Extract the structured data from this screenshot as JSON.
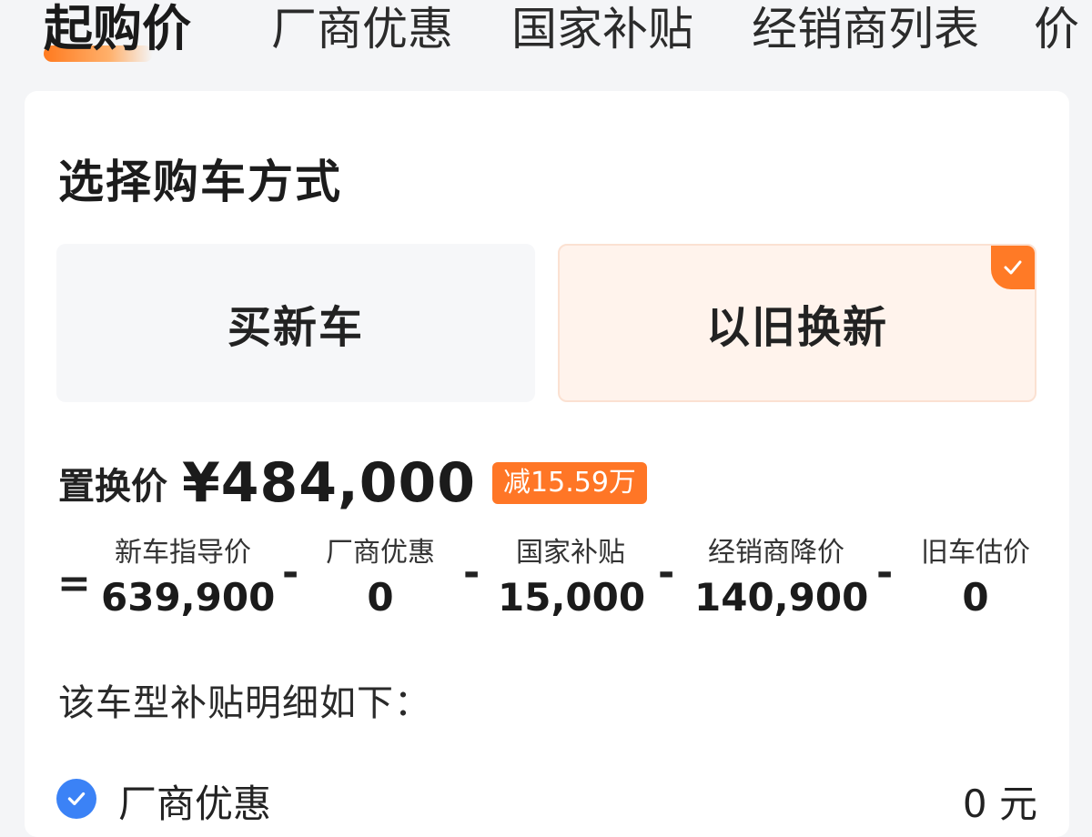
{
  "tabs": [
    {
      "label": "起购价",
      "active": true
    },
    {
      "label": "厂商优惠",
      "active": false
    },
    {
      "label": "国家补贴",
      "active": false
    },
    {
      "label": "经销商列表",
      "active": false
    },
    {
      "label": "价",
      "active": false
    }
  ],
  "purchase_method": {
    "title": "选择购车方式",
    "options": [
      {
        "label": "买新车",
        "selected": false
      },
      {
        "label": "以旧换新",
        "selected": true
      }
    ]
  },
  "price": {
    "label": "置换价",
    "value": "¥484,000",
    "discount_badge": "减15.59万"
  },
  "formula": {
    "equals": "=",
    "minus": "-",
    "terms": [
      {
        "label": "新车指导价",
        "value": "639,900"
      },
      {
        "label": "厂商优惠",
        "value": "0"
      },
      {
        "label": "国家补贴",
        "value": "15,000"
      },
      {
        "label": "经销商降价",
        "value": "140,900"
      },
      {
        "label": "旧车估价",
        "value": "0"
      }
    ]
  },
  "subsidy_detail": {
    "title": "该车型补贴明细如下：",
    "rows": [
      {
        "label": "厂商优惠",
        "value": "0 元",
        "checked": true
      }
    ]
  },
  "colors": {
    "accent": "#ff7626",
    "selected_bg": "#fff3ec",
    "check_blue": "#3b82f6"
  },
  "icons": {
    "selected_corner": "checkmark-icon",
    "detail_check": "check-circle-icon"
  }
}
